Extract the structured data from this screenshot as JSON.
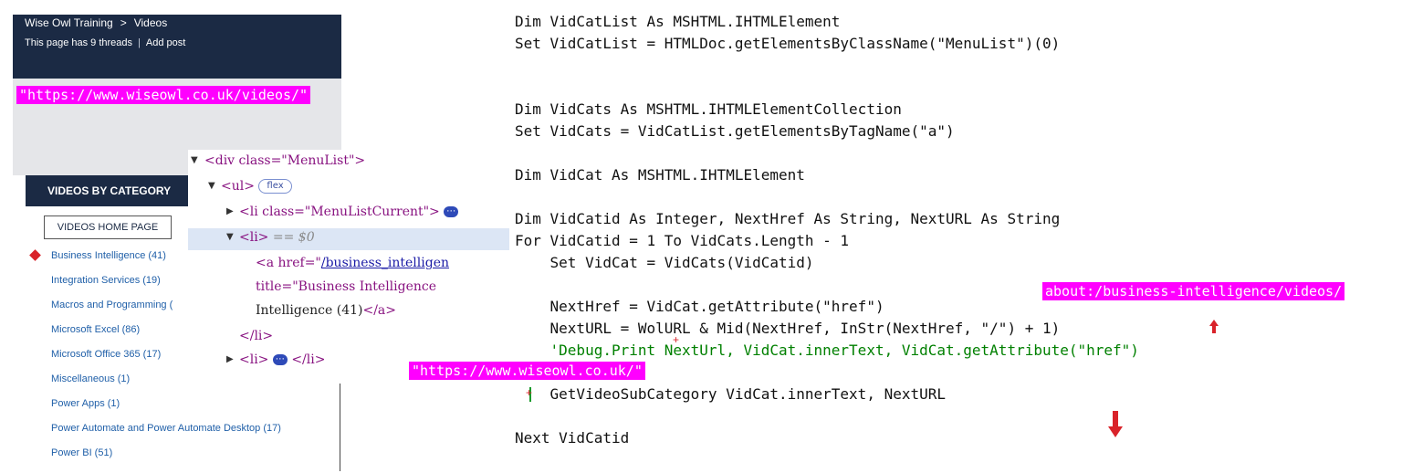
{
  "site": {
    "breadcrumb_home": "Wise Owl Training",
    "breadcrumb_sep": ">",
    "breadcrumb_current": "Videos",
    "threads_text": "This page has 9 threads",
    "add_post": "Add post",
    "url_tag": "\"https://www.wiseowl.co.uk/videos/\"",
    "category_header": "VIDEOS BY CATEGORY",
    "home_button": "VIDEOS HOME PAGE",
    "categories": [
      "Business Intelligence (41)",
      "Integration Services (19)",
      "Macros and Programming (",
      "Microsoft Excel (86)",
      "Microsoft Office 365 (17)",
      "Miscellaneous (1)",
      "Power Apps (1)",
      "Power Automate and Power Automate Desktop (17)",
      "Power BI (51)"
    ]
  },
  "devtools": {
    "l1": "<div class=\"MenuList\">",
    "l2_tag": "<ul>",
    "l2_pill": "flex",
    "l3": "<li class=\"MenuListCurrent\">",
    "l3_dots": "⋯",
    "l4_tag": "<li>",
    "l4_eq": "== $0",
    "l5_open": "<a href=\"",
    "l5_href": "/business_intelligen",
    "l6": "title=\"Business Intelligence",
    "l7_text": "Intelligence (41)",
    "l7_close": "</a>",
    "l8": "</li>",
    "l9_open": "<li>",
    "l9_dots": "⋯",
    "l9_close": "</li>"
  },
  "code": {
    "line1": "Dim VidCatList As MSHTML.IHTMLElement",
    "line2": "Set VidCatList = HTMLDoc.getElementsByClassName(\"MenuList\")(0)",
    "line3": "Dim VidCats As MSHTML.IHTMLElementCollection",
    "line4": "Set VidCats = VidCatList.getElementsByTagName(\"a\")",
    "line5": "Dim VidCat As MSHTML.IHTMLElement",
    "line6": "Dim VidCatid As Integer, NextHref As String, NextURL As String",
    "line7": "For VidCatid = 1 To VidCats.Length - 1",
    "line8": "    Set VidCat = VidCats(VidCatid)",
    "line9": "    NextHref = VidCat.getAttribute(\"href\")",
    "line10": "    NextURL = WolURL & Mid(NextHref, InStr(NextHref, \"/\") + 1)",
    "line11": "    'Debug.Print NextUrl, VidCat.innerText, VidCat.getAttribute(\"href\")",
    "line12": "    GetVideoSubCategory VidCat.innerText, NextURL",
    "line13": "Next VidCatid"
  },
  "annotations": {
    "about_tag": "about:/business-intelligence/videos/",
    "url_tag_2": "\"https://www.wiseowl.co.uk/\""
  },
  "colors": {
    "highlight": "#ff00ff",
    "header_navy": "#1b2a44",
    "arrow_red": "#d9232a",
    "keyword_blue": "#1010c0",
    "comment_green": "#008000"
  }
}
